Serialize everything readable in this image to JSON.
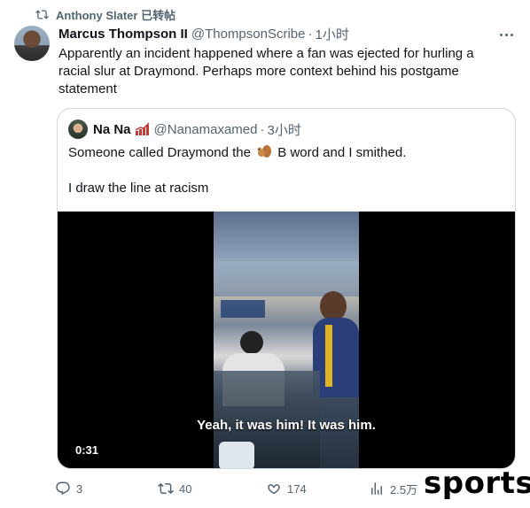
{
  "retweet": {
    "label": "Anthony Slater 已转帖",
    "icon": "retweet-icon"
  },
  "tweet": {
    "author_name": "Marcus Thompson II",
    "author_handle": "@ThompsonScribe",
    "separator": "·",
    "time": "1小时",
    "text": "Apparently an incident happened where a fan was ejected for hurling a racial slur at Draymond. Perhaps more context behind his postgame statement",
    "more_icon": "more-horizontal-icon"
  },
  "quoted_tweet": {
    "author_name": "Na Na",
    "author_handle": "@Nanamaxamed",
    "separator": "·",
    "time": "3小时",
    "text_before_emoji": "Someone called Draymond the",
    "emoji": "squirrel-emoji",
    "text_after_emoji": "B word and I smithed.",
    "text_line2": "I draw the line at racism",
    "video": {
      "caption": "Yeah, it was him! It was him.",
      "duration": "0:31"
    }
  },
  "actions": {
    "replies": "3",
    "retweets": "40",
    "likes": "174",
    "views": "2.5万"
  },
  "watermark": "sports"
}
